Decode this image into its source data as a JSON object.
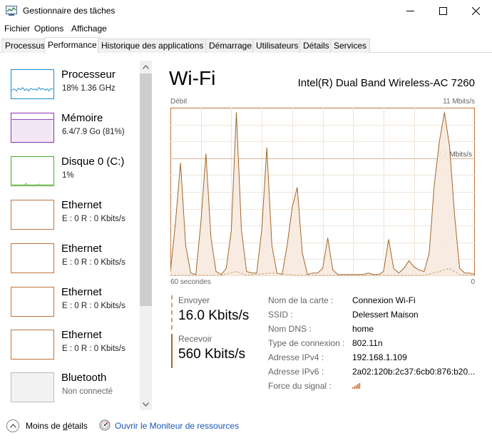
{
  "window": {
    "title": "Gestionnaire des tâches"
  },
  "menu": [
    "Fichier",
    "Options",
    "Affichage"
  ],
  "tabs": [
    "Processus",
    "Performance",
    "Historique des applications",
    "Démarrage",
    "Utilisateurs",
    "Détails",
    "Services"
  ],
  "active_tab": "Performance",
  "sidebar": {
    "items": [
      {
        "name": "Processeur",
        "sub": "18%  1.36 GHz",
        "color": "#1a8ad4"
      },
      {
        "name": "Mémoire",
        "sub": "6.4/7.9 Go (81%)",
        "color": "#8b2bb5"
      },
      {
        "name": "Disque 0 (C:)",
        "sub": "1%",
        "color": "#4ea72e"
      },
      {
        "name": "Ethernet",
        "sub": "E : 0  R : 0 Kbits/s",
        "color": "#c0733b"
      },
      {
        "name": "Ethernet",
        "sub": "E : 0  R : 0 Kbits/s",
        "color": "#c0733b"
      },
      {
        "name": "Ethernet",
        "sub": "E : 0  R : 0 Kbits/s",
        "color": "#c0733b"
      },
      {
        "name": "Ethernet",
        "sub": "E : 0  R : 0 Kbits/s",
        "color": "#c0733b"
      },
      {
        "name": "Bluetooth",
        "sub": "Non connecté",
        "color": "#bbbbbb"
      }
    ]
  },
  "main": {
    "title": "Wi-Fi",
    "adapter": "Intel(R) Dual Band Wireless-AC 7260",
    "axis_top_left": "Débit",
    "axis_top_right": "11 Mbits/s",
    "axis_bottom_left": "60 secondes",
    "axis_bottom_right": "0",
    "send_label": "Envoyer",
    "send_value": "16.0 Kbits/s",
    "recv_label": "Recevoir",
    "recv_value": "560 Kbits/s",
    "properties": [
      {
        "k": "Nom de la carte :",
        "v": "Connexion Wi-Fi"
      },
      {
        "k": "SSID :",
        "v": "Delessert Maison"
      },
      {
        "k": "Nom DNS :",
        "v": "home"
      },
      {
        "k": "Type de connexion :",
        "v": "802.11n"
      },
      {
        "k": "Adresse IPv4 :",
        "v": "192.168.1.109"
      },
      {
        "k": "Adresse IPv6 :",
        "v": "2a02:120b:2c37:6cb0:876:b20..."
      },
      {
        "k": "Force du signal :",
        "v": ""
      }
    ]
  },
  "chart_data": {
    "type": "area",
    "xlabel": "60 secondes",
    "ylabel": "Débit",
    "xlim": [
      60,
      0
    ],
    "ylim": [
      0,
      11
    ],
    "y_unit": "Mbits/s",
    "annotation": {
      "label": "7,7 Mbits/s",
      "y": 7.7
    },
    "grid": true,
    "series": [
      {
        "name": "Recevoir",
        "color": "#a0682c",
        "x": [
          60,
          59,
          58,
          57,
          56,
          55,
          54,
          53,
          52,
          51,
          50,
          49,
          48,
          47,
          46,
          45,
          44,
          43,
          42,
          41,
          40,
          39,
          38,
          37,
          36,
          35,
          34,
          33,
          32,
          31,
          30,
          29,
          28,
          27,
          26,
          25,
          24,
          23,
          22,
          21,
          20,
          19,
          18,
          17,
          16,
          15,
          14,
          13,
          12,
          11,
          10,
          9,
          8,
          7,
          6,
          5,
          4,
          3,
          2,
          1,
          0
        ],
        "values": [
          0.3,
          3.5,
          7.4,
          2,
          0.2,
          0.1,
          3.5,
          8.0,
          2.5,
          0.3,
          0.1,
          0.5,
          3,
          10.7,
          3,
          0.3,
          0.2,
          0.2,
          3,
          8.4,
          2,
          0.2,
          0.1,
          2,
          4.5,
          5.8,
          1.5,
          0.1,
          0.2,
          0.2,
          0.5,
          2.5,
          0.4,
          0.1,
          0.1,
          0.1,
          0.1,
          0.1,
          0.1,
          0.2,
          0.1,
          0.1,
          0.3,
          2.4,
          0.5,
          0.2,
          0.5,
          1,
          0.6,
          0.4,
          0.3,
          1.5,
          6,
          8.8,
          10.7,
          8.5,
          4,
          0.5,
          0.2,
          0.2,
          0.1
        ]
      },
      {
        "name": "Envoyer",
        "color": "#c9a27a",
        "dashed": true,
        "x": [
          60,
          55,
          50,
          47,
          45,
          40,
          35,
          30,
          25,
          20,
          15,
          10,
          7,
          5,
          3,
          0
        ],
        "values": [
          0.05,
          0.05,
          0.05,
          0.3,
          0.05,
          0.2,
          0.05,
          0.05,
          0.05,
          0.05,
          0.05,
          0.05,
          0.3,
          0.5,
          0.1,
          0.05
        ]
      }
    ]
  }
}
